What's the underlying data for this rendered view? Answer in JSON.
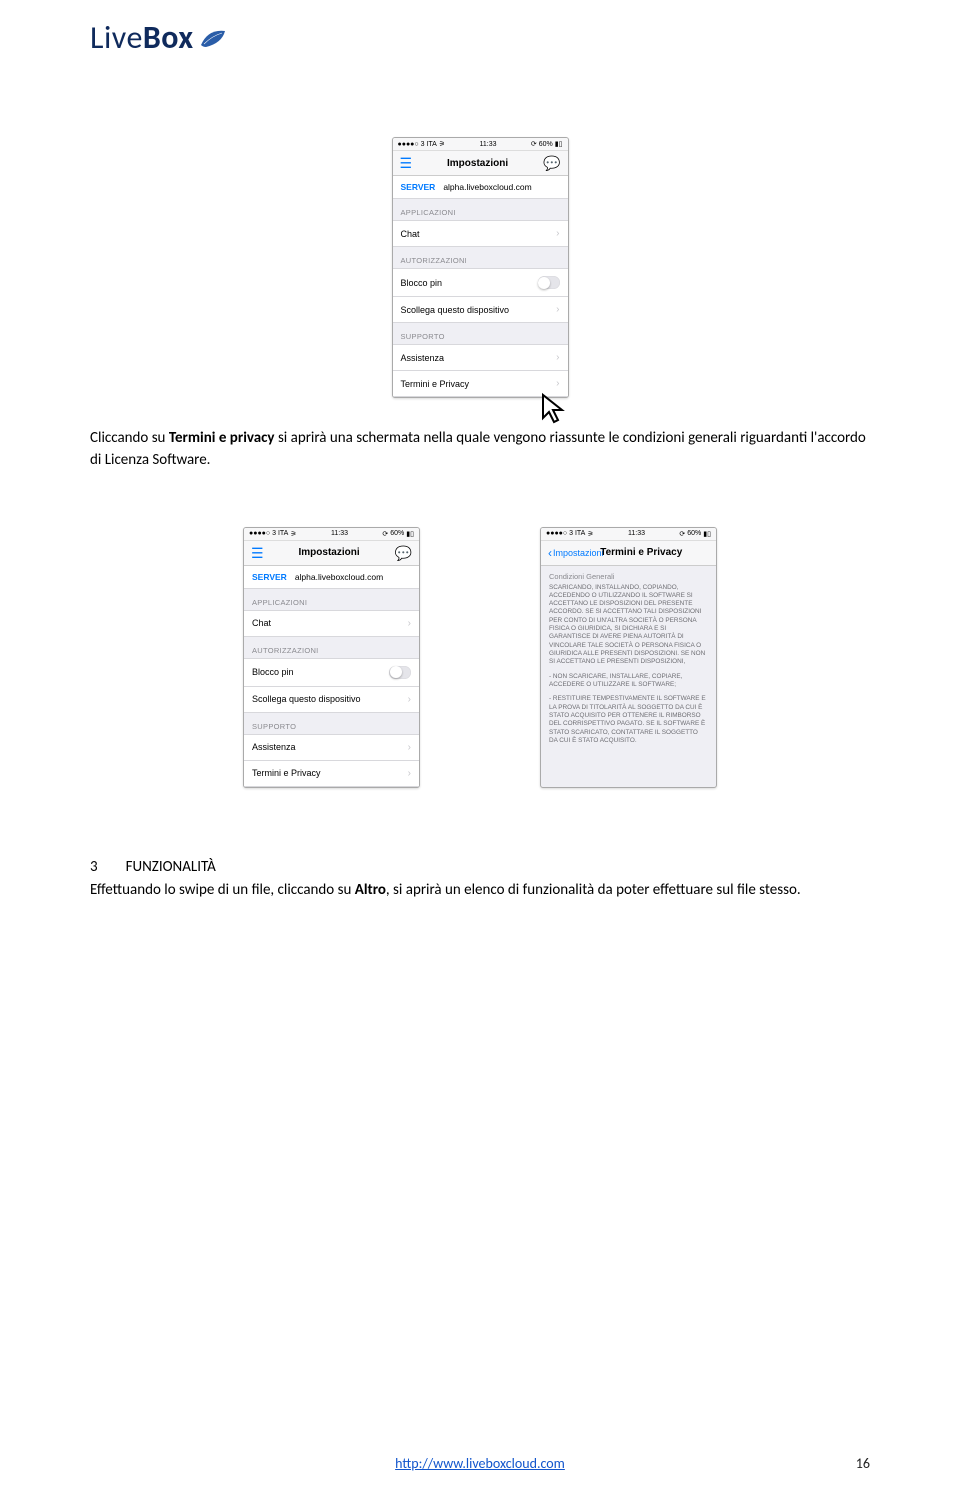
{
  "logo": {
    "text1": "Live",
    "text2": "Box"
  },
  "status": {
    "carrier": "3 ITA",
    "time": "11:33",
    "battery": "60%"
  },
  "screen_settings": {
    "title": "Impostazioni",
    "server_label": "SERVER",
    "server_value": "alpha.liveboxcloud.com",
    "section_apps": "APPLICAZIONI",
    "row_chat": "Chat",
    "section_auth": "AUTORIZZAZIONI",
    "row_pin": "Blocco pin",
    "row_unlink": "Scollega questo dispositivo",
    "section_support": "SUPPORTO",
    "row_help": "Assistenza",
    "row_terms": "Termini e Privacy"
  },
  "screen_terms": {
    "back": "Impostazioni",
    "title": "Termini e Privacy",
    "subtitle": "Condizioni Generali",
    "p1": "SCARICANDO, INSTALLANDO, COPIANDO, ACCEDENDO O UTILIZZANDO IL SOFTWARE SI ACCETTANO LE DISPOSIZIONI DEL PRESENTE ACCORDO. SE SI ACCETTANO TALI DISPOSIZIONI PER CONTO DI UN'ALTRA SOCIETÀ O PERSONA FISICA O GIURIDICA, SI DICHIARA E SI GARANTISCE DI AVERE PIENA AUTORITÀ DI VINCOLARE TALE SOCIETÀ O PERSONA FISICA O GIURIDICA ALLE PRESENTI DISPOSIZIONI. SE NON SI ACCETTANO LE PRESENTI DISPOSIZIONI,",
    "p2": "- NON SCARICARE, INSTALLARE, COPIARE, ACCEDERE O UTILIZZARE IL SOFTWARE;",
    "p3": "- RESTITUIRE TEMPESTIVAMENTE IL SOFTWARE E LA PROVA DI TITOLARITÀ AL SOGGETTO DA CUI È STATO ACQUISITO PER OTTENERE IL RIMBORSO DEL CORRISPETTIVO PAGATO. SE IL SOFTWARE È STATO SCARICATO, CONTATTARE IL SOGGETTO DA CUI È STATO ACQUISITO."
  },
  "para1_pre": "Cliccando su ",
  "para1_bold": "Termini e privacy",
  "para1_post": " si aprirà una schermata nella quale vengono riassunte le condizioni generali riguardanti l'accordo di Licenza Software.",
  "heading_num": "3",
  "heading_text": "FUNZIONALITÀ",
  "para2_pre": "Effettuando lo swipe di un file, cliccando su ",
  "para2_bold": "Altro",
  "para2_post": ", si aprirà un elenco di funzionalità da poter effettuare sul file stesso.",
  "footer_url": "http://www.liveboxcloud.com",
  "page_number": "16"
}
